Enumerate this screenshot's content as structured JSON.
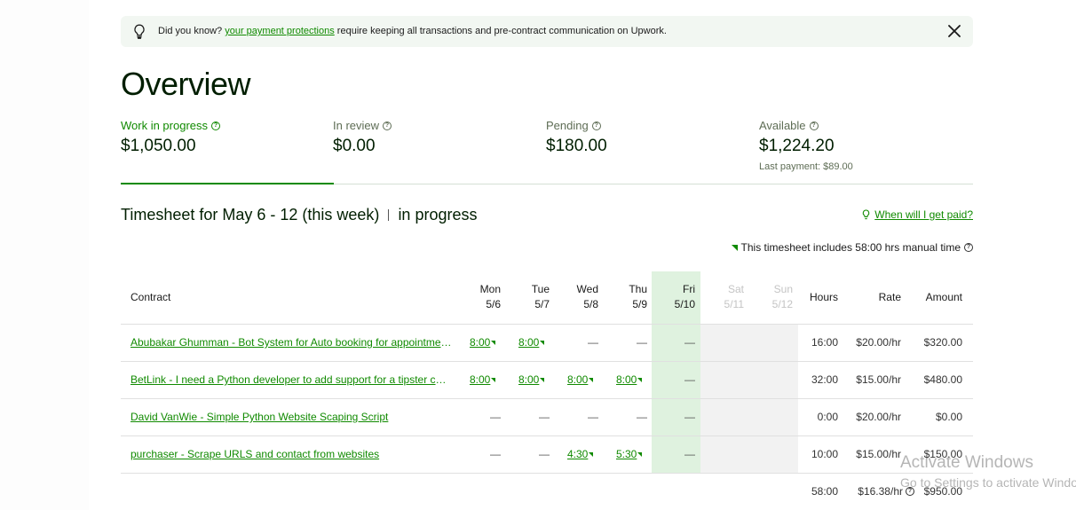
{
  "tip": {
    "prefix": "Did you know?",
    "link": "your payment protections",
    "suffix": "require keeping all transactions and pre-contract communication on Upwork."
  },
  "title": "Overview",
  "stats": [
    {
      "label": "Work in progress",
      "value": "$1,050.00",
      "sub": ""
    },
    {
      "label": "In review",
      "value": "$0.00",
      "sub": ""
    },
    {
      "label": "Pending",
      "value": "$180.00",
      "sub": ""
    },
    {
      "label": "Available",
      "value": "$1,224.20",
      "sub": "Last payment: $89.00"
    }
  ],
  "timesheet": {
    "title": "Timesheet for May 6 - 12 (this week)",
    "status": "in progress",
    "paid_link": "When will I get paid?",
    "manual_note": "This timesheet includes 58:00 hrs manual time"
  },
  "table": {
    "headers": {
      "contract": "Contract",
      "days": [
        {
          "d": "Mon",
          "date": "5/6"
        },
        {
          "d": "Tue",
          "date": "5/7"
        },
        {
          "d": "Wed",
          "date": "5/8"
        },
        {
          "d": "Thu",
          "date": "5/9"
        },
        {
          "d": "Fri",
          "date": "5/10"
        },
        {
          "d": "Sat",
          "date": "5/11"
        },
        {
          "d": "Sun",
          "date": "5/12"
        }
      ],
      "hours": "Hours",
      "rate": "Rate",
      "amount": "Amount"
    },
    "rows": [
      {
        "contract": "Abubakar Ghumman - Bot System for Auto booking for appointments",
        "days": [
          "8:00",
          "8:00",
          "—",
          "—",
          "—"
        ],
        "hours": "16:00",
        "rate": "$20.00/hr",
        "amount": "$320.00"
      },
      {
        "contract": "BetLink - I need a Python developer to add support for a tipster chatbot",
        "days": [
          "8:00",
          "8:00",
          "8:00",
          "8:00",
          "—"
        ],
        "hours": "32:00",
        "rate": "$15.00/hr",
        "amount": "$480.00"
      },
      {
        "contract": "David VanWie - Simple Python Website Scaping Script",
        "days": [
          "—",
          "—",
          "—",
          "—",
          "—"
        ],
        "hours": "0:00",
        "rate": "$20.00/hr",
        "amount": "$0.00"
      },
      {
        "contract": "purchaser - Scrape URLS and contact from websites",
        "days": [
          "—",
          "—",
          "4:30",
          "5:30",
          "—"
        ],
        "hours": "10:00",
        "rate": "$15.00/hr",
        "amount": "$150.00"
      }
    ],
    "totals": {
      "hours": "58:00",
      "rate": "$16.38/hr",
      "amount": "$950.00"
    }
  },
  "watermark": {
    "line1": "Activate Windows",
    "line2": "Go to Settings to activate Windows."
  }
}
